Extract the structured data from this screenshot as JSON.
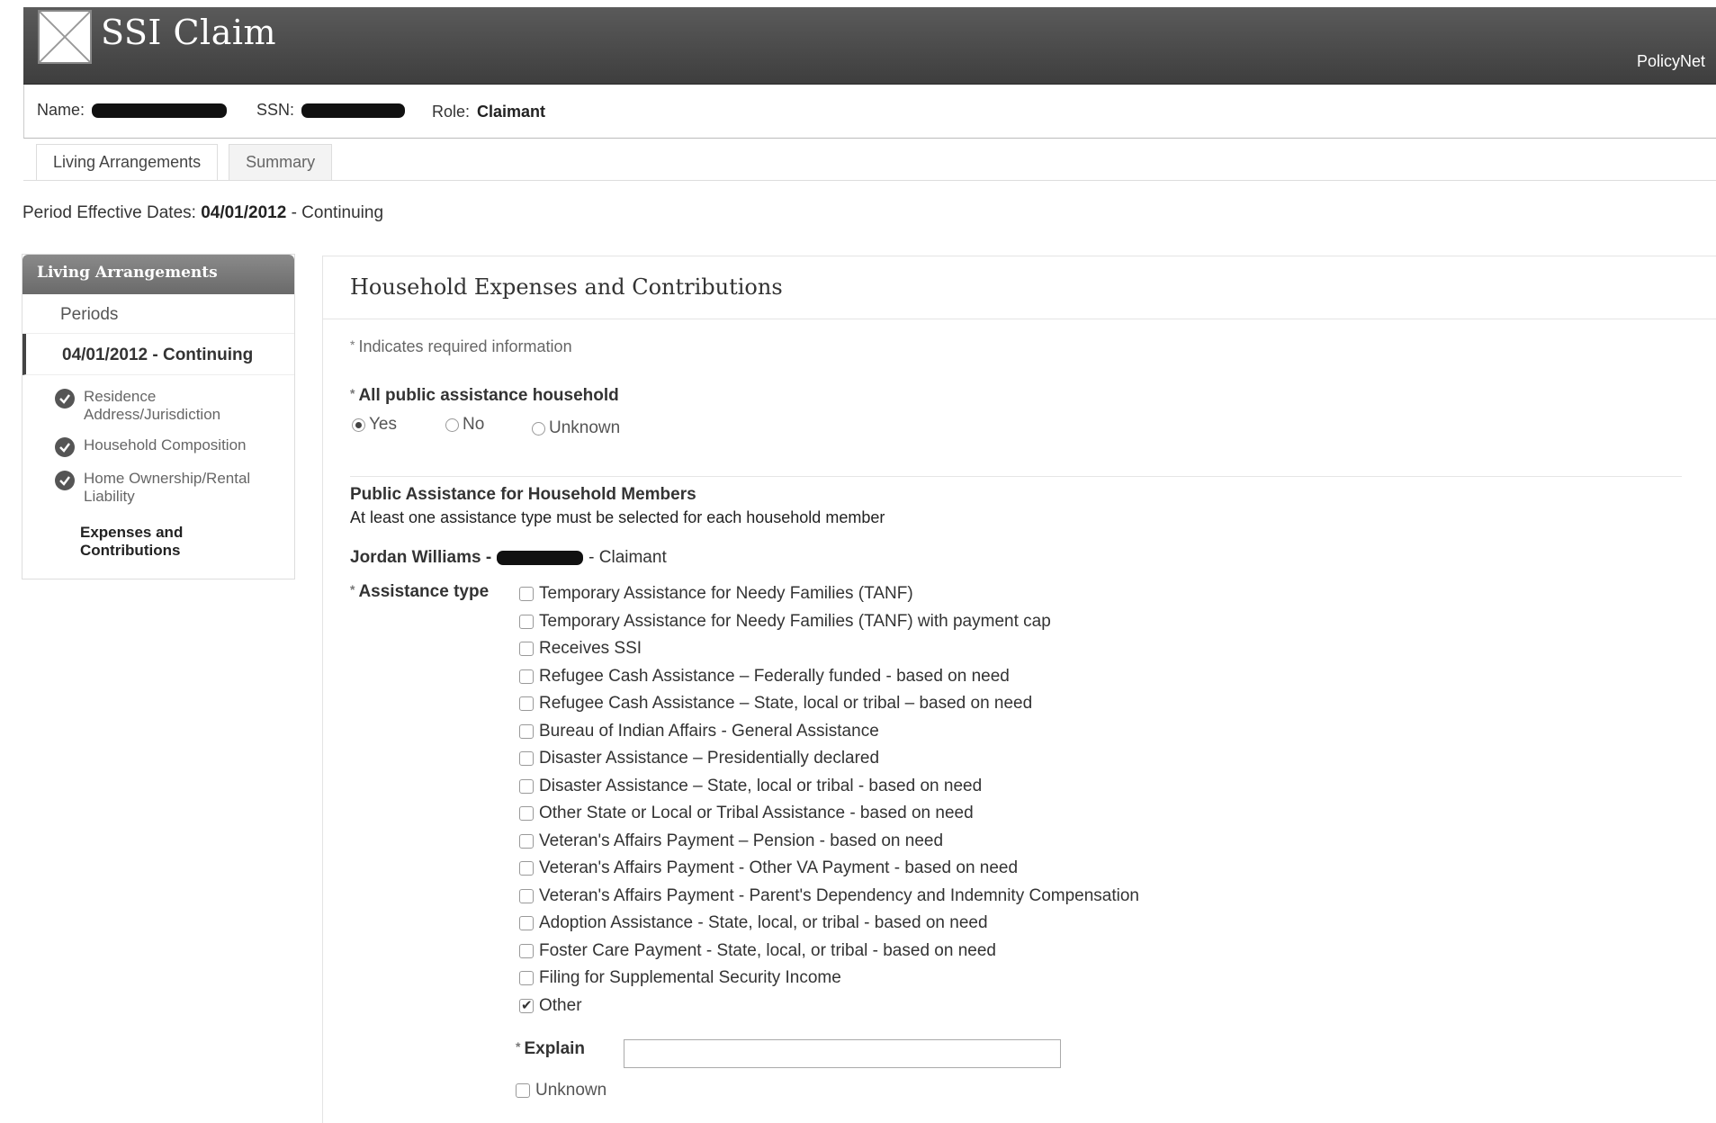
{
  "header": {
    "title": "SSI Claim",
    "brand": "PolicyNet",
    "logo_icon": "image-placeholder-icon"
  },
  "claimant": {
    "name_label": "Name:",
    "ssn_label": "SSN:",
    "role_label": "Role:",
    "role_value": "Claimant"
  },
  "tabs": [
    {
      "label": "Living Arrangements",
      "active": true
    },
    {
      "label": "Summary",
      "active": false
    }
  ],
  "period": {
    "label": "Period Effective Dates:",
    "start": "04/01/2012",
    "end": "- Continuing"
  },
  "sidebar": {
    "title": "Living Arrangements",
    "periods_label": "Periods",
    "period_item": "04/01/2012 - Continuing",
    "steps": [
      {
        "label": "Residence Address/Jurisdiction",
        "complete": true
      },
      {
        "label": "Household Composition",
        "complete": true
      },
      {
        "label": "Home Ownership/Rental Liability",
        "complete": true
      },
      {
        "label": "Expenses and Contributions",
        "current": true
      }
    ]
  },
  "main": {
    "section_title": "Household Expenses and Contributions",
    "required_note": "Indicates required information",
    "public_assistance_question": "All public assistance household",
    "radio_options": [
      {
        "label": "Yes",
        "selected": true
      },
      {
        "label": "No",
        "selected": false
      },
      {
        "label": "Unknown",
        "selected": false
      }
    ],
    "members_heading": "Public Assistance for Household Members",
    "members_note": "At least one assistance type must be selected for each household member",
    "member_name": "Jordan Williams -",
    "member_role": "- Claimant",
    "assistance_type_label": "Assistance type",
    "assistance_types": [
      {
        "label": "Temporary Assistance for Needy Families (TANF)",
        "checked": false
      },
      {
        "label": "Temporary Assistance for Needy Families (TANF) with payment cap",
        "checked": false
      },
      {
        "label": "Receives SSI",
        "checked": false
      },
      {
        "label": "Refugee Cash Assistance – Federally funded - based on need",
        "checked": false
      },
      {
        "label": "Refugee Cash Assistance – State, local or tribal – based on need",
        "checked": false
      },
      {
        "label": "Bureau of Indian Affairs - General Assistance",
        "checked": false
      },
      {
        "label": "Disaster Assistance – Presidentially declared",
        "checked": false
      },
      {
        "label": "Disaster Assistance – State, local or tribal - based on need",
        "checked": false
      },
      {
        "label": "Other State or Local or Tribal Assistance - based on need",
        "checked": false
      },
      {
        "label": "Veteran's Affairs Payment – Pension - based on need",
        "checked": false
      },
      {
        "label": "Veteran's Affairs Payment - Other VA Payment - based on need",
        "checked": false
      },
      {
        "label": "Veteran's Affairs Payment - Parent's Dependency and Indemnity Compensation",
        "checked": false
      },
      {
        "label": "Adoption Assistance - State, local, or tribal - based on need",
        "checked": false
      },
      {
        "label": "Foster Care Payment - State, local, or tribal - based on need",
        "checked": false
      },
      {
        "label": "Filing  for Supplemental Security Income",
        "checked": false
      },
      {
        "label": "Other",
        "checked": true
      }
    ],
    "explain_label": "Explain",
    "explain_value": "",
    "unknown_label": "Unknown"
  }
}
